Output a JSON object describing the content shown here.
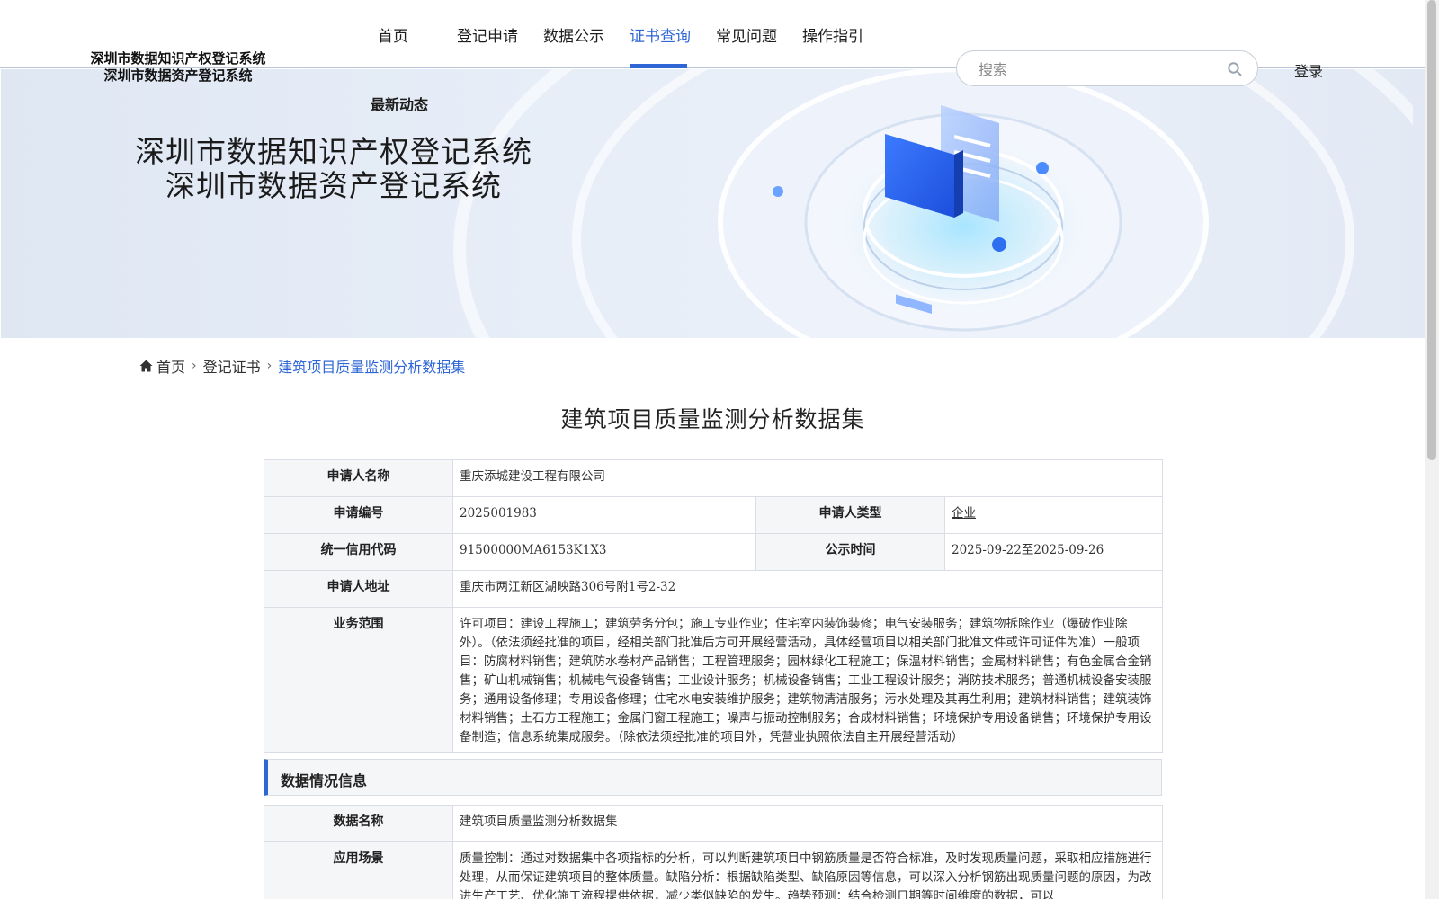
{
  "site": {
    "title_line1": "深圳市数据知识产权登记系统",
    "title_line2": "深圳市数据资产登记系统"
  },
  "nav": {
    "items": [
      {
        "label": "首页"
      },
      {
        "label": "登记申请"
      },
      {
        "label": "数据公示"
      },
      {
        "label": "证书查询"
      },
      {
        "label": "常见问题"
      },
      {
        "label": "操作指引"
      }
    ],
    "active_index": 3,
    "extra": "最新动态",
    "accent_color": "#2e66d6"
  },
  "search": {
    "placeholder": "搜索",
    "value": "",
    "icon": "search-icon"
  },
  "login": "登录",
  "banner": {
    "title_line1": "深圳市数据知识产权登记系统",
    "title_line2": "深圳市数据资产登记系统"
  },
  "breadcrumb": {
    "home": "首页",
    "level2": "登记证书",
    "current": "建筑项目质量监测分析数据集",
    "home_icon": "home-icon",
    "separator_icon": "chevron-right-icon"
  },
  "page_title": "建筑项目质量监测分析数据集",
  "applicant": {
    "name_label": "申请人名称",
    "name": "重庆添城建设工程有限公司",
    "number_label": "申请编号",
    "number": "2025001983",
    "type_label": "申请人类型",
    "type": "企业",
    "credit_label": "统一信用代码",
    "credit": "91500000MA6153K1X3",
    "period_label": "公示时间",
    "period": "2025-09-22至2025-09-26",
    "address_label": "申请人地址",
    "address": "重庆市两江新区湖映路306号附1号2-32",
    "scope_label": "业务范围",
    "scope": "许可项目：建设工程施工；建筑劳务分包；施工专业作业；住宅室内装饰装修；电气安装服务；建筑物拆除作业（爆破作业除外）。（依法须经批准的项目，经相关部门批准后方可开展经营活动，具体经营项目以相关部门批准文件或许可证件为准）一般项目：防腐材料销售；建筑防水卷材产品销售；工程管理服务；园林绿化工程施工；保温材料销售；金属材料销售；有色金属合金销售；矿山机械销售；机械电气设备销售；工业设计服务；机械设备销售；工业工程设计服务；消防技术服务；普通机械设备安装服务；通用设备修理；专用设备修理；住宅水电安装维护服务；建筑物清洁服务；污水处理及其再生利用；建筑材料销售；建筑装饰材料销售；土石方工程施工；金属门窗工程施工；噪声与振动控制服务；合成材料销售；环境保护专用设备销售；环境保护专用设备制造；信息系统集成服务。（除依法须经批准的项目外，凭营业执照依法自主开展经营活动）"
  },
  "data_section": {
    "heading": "数据情况信息",
    "name_label": "数据名称",
    "name": "建筑项目质量监测分析数据集",
    "scenario_label": "应用场景",
    "scenario": "质量控制：通过对数据集中各项指标的分析，可以判断建筑项目中钢筋质量是否符合标准，及时发现质量问题，采取相应措施进行处理，从而保证建筑项目的整体质量。缺陷分析：根据缺陷类型、缺陷原因等信息，可以深入分析钢筋出现质量问题的原因，为改进生产工艺、优化施工流程提供依据，减少类似缺陷的发生。趋势预测：结合检测日期等时间维度的数据，可以"
  }
}
